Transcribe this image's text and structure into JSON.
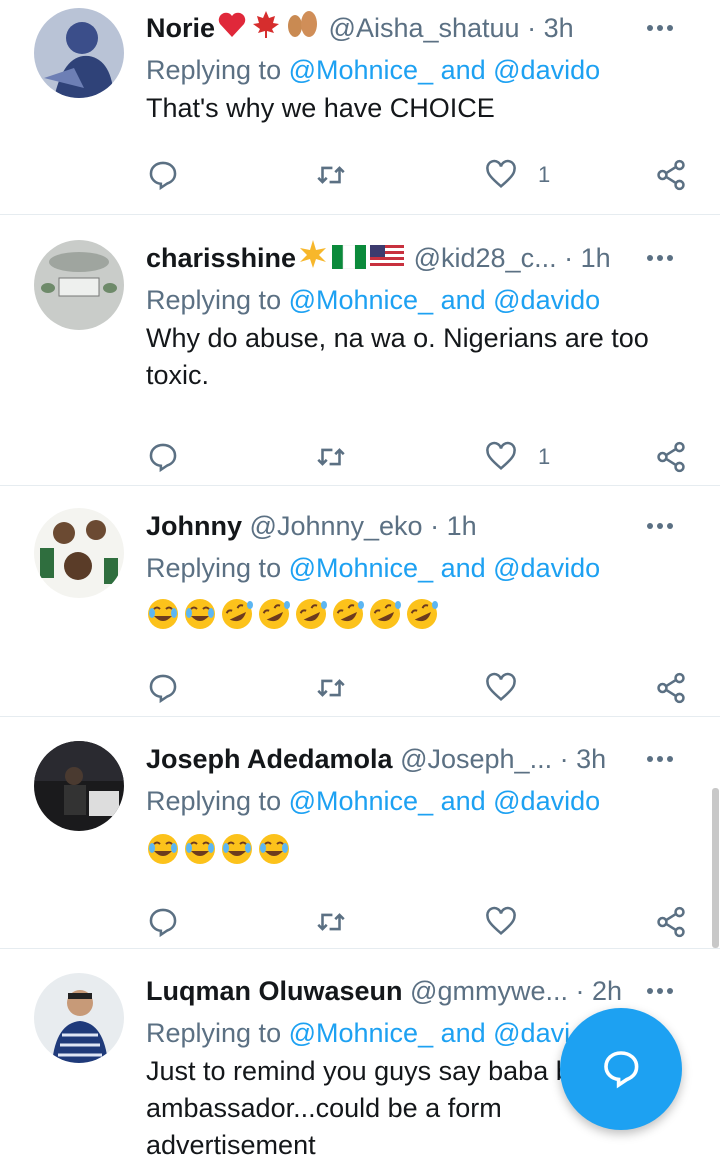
{
  "colors": {
    "accent": "#1da1f2",
    "muted": "#5b7083",
    "text": "#14171a",
    "divider": "#e6ecf0"
  },
  "tweets": [
    {
      "name": "Norie",
      "handle": "@Aisha_shatuu",
      "time": "· 3h",
      "reply_prefix": "Replying to",
      "reply_users": "@Mohnice_ and @davido",
      "text": "That's why we have CHOICE",
      "like_count": "1"
    },
    {
      "name": "charisshine",
      "handle": "@kid28_c...",
      "time": "· 1h",
      "reply_prefix": "Replying to",
      "reply_users": "@Mohnice_ and @davido",
      "text": "Why do abuse, na wa o. Nigerians are too toxic.",
      "like_count": "1"
    },
    {
      "name": "Johnny",
      "handle": "@Johnny_eko",
      "time": "· 1h",
      "reply_prefix": "Replying to",
      "reply_users": "@Mohnice_ and @davido",
      "text": "",
      "like_count": ""
    },
    {
      "name": "Joseph Adedamola",
      "handle": "@Joseph_...",
      "time": "· 3h",
      "reply_prefix": "Replying to",
      "reply_users": "@Mohnice_ and @davido",
      "text": "",
      "like_count": ""
    },
    {
      "name": "Luqman Oluwaseun",
      "handle": "@gmmywe...",
      "time": "· 2h",
      "reply_prefix": "Replying to",
      "reply_users": "@Mohnice_ and @davi",
      "text": "Just to remind you guys say baba brand ambassador...could be a form advertisement",
      "like_count": ""
    }
  ],
  "icons": {
    "reply": "reply-icon",
    "retweet": "retweet-icon",
    "like": "heart-icon",
    "share": "share-icon",
    "more": "more-icon",
    "compose": "compose-reply-icon"
  }
}
